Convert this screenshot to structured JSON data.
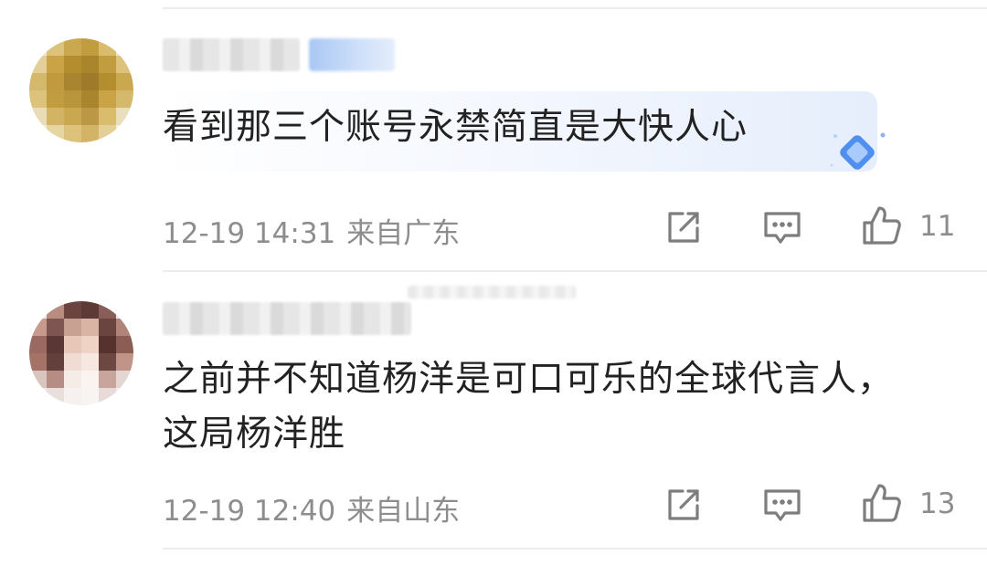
{
  "comments": [
    {
      "text_lines": [
        "看到那三个账号永禁简直是大快人心"
      ],
      "date": "12-19 14:31",
      "location": "来自广东",
      "likes": "11",
      "icons": {
        "share": "share-edit-icon",
        "reply": "comment-icon",
        "like": "thumbs-up-icon"
      }
    },
    {
      "text_lines": [
        "之前并不知道杨洋是可口可乐的全球代言人，",
        "这局杨洋胜"
      ],
      "date": "12-19 12:40",
      "location": "来自山东",
      "likes": "13",
      "icons": {
        "share": "share-edit-icon",
        "reply": "comment-icon",
        "like": "thumbs-up-icon"
      }
    }
  ],
  "colors": {
    "text": "#222222",
    "meta": "#8d8d8d",
    "divider": "#ececec",
    "badge": "#a9c7f3"
  }
}
